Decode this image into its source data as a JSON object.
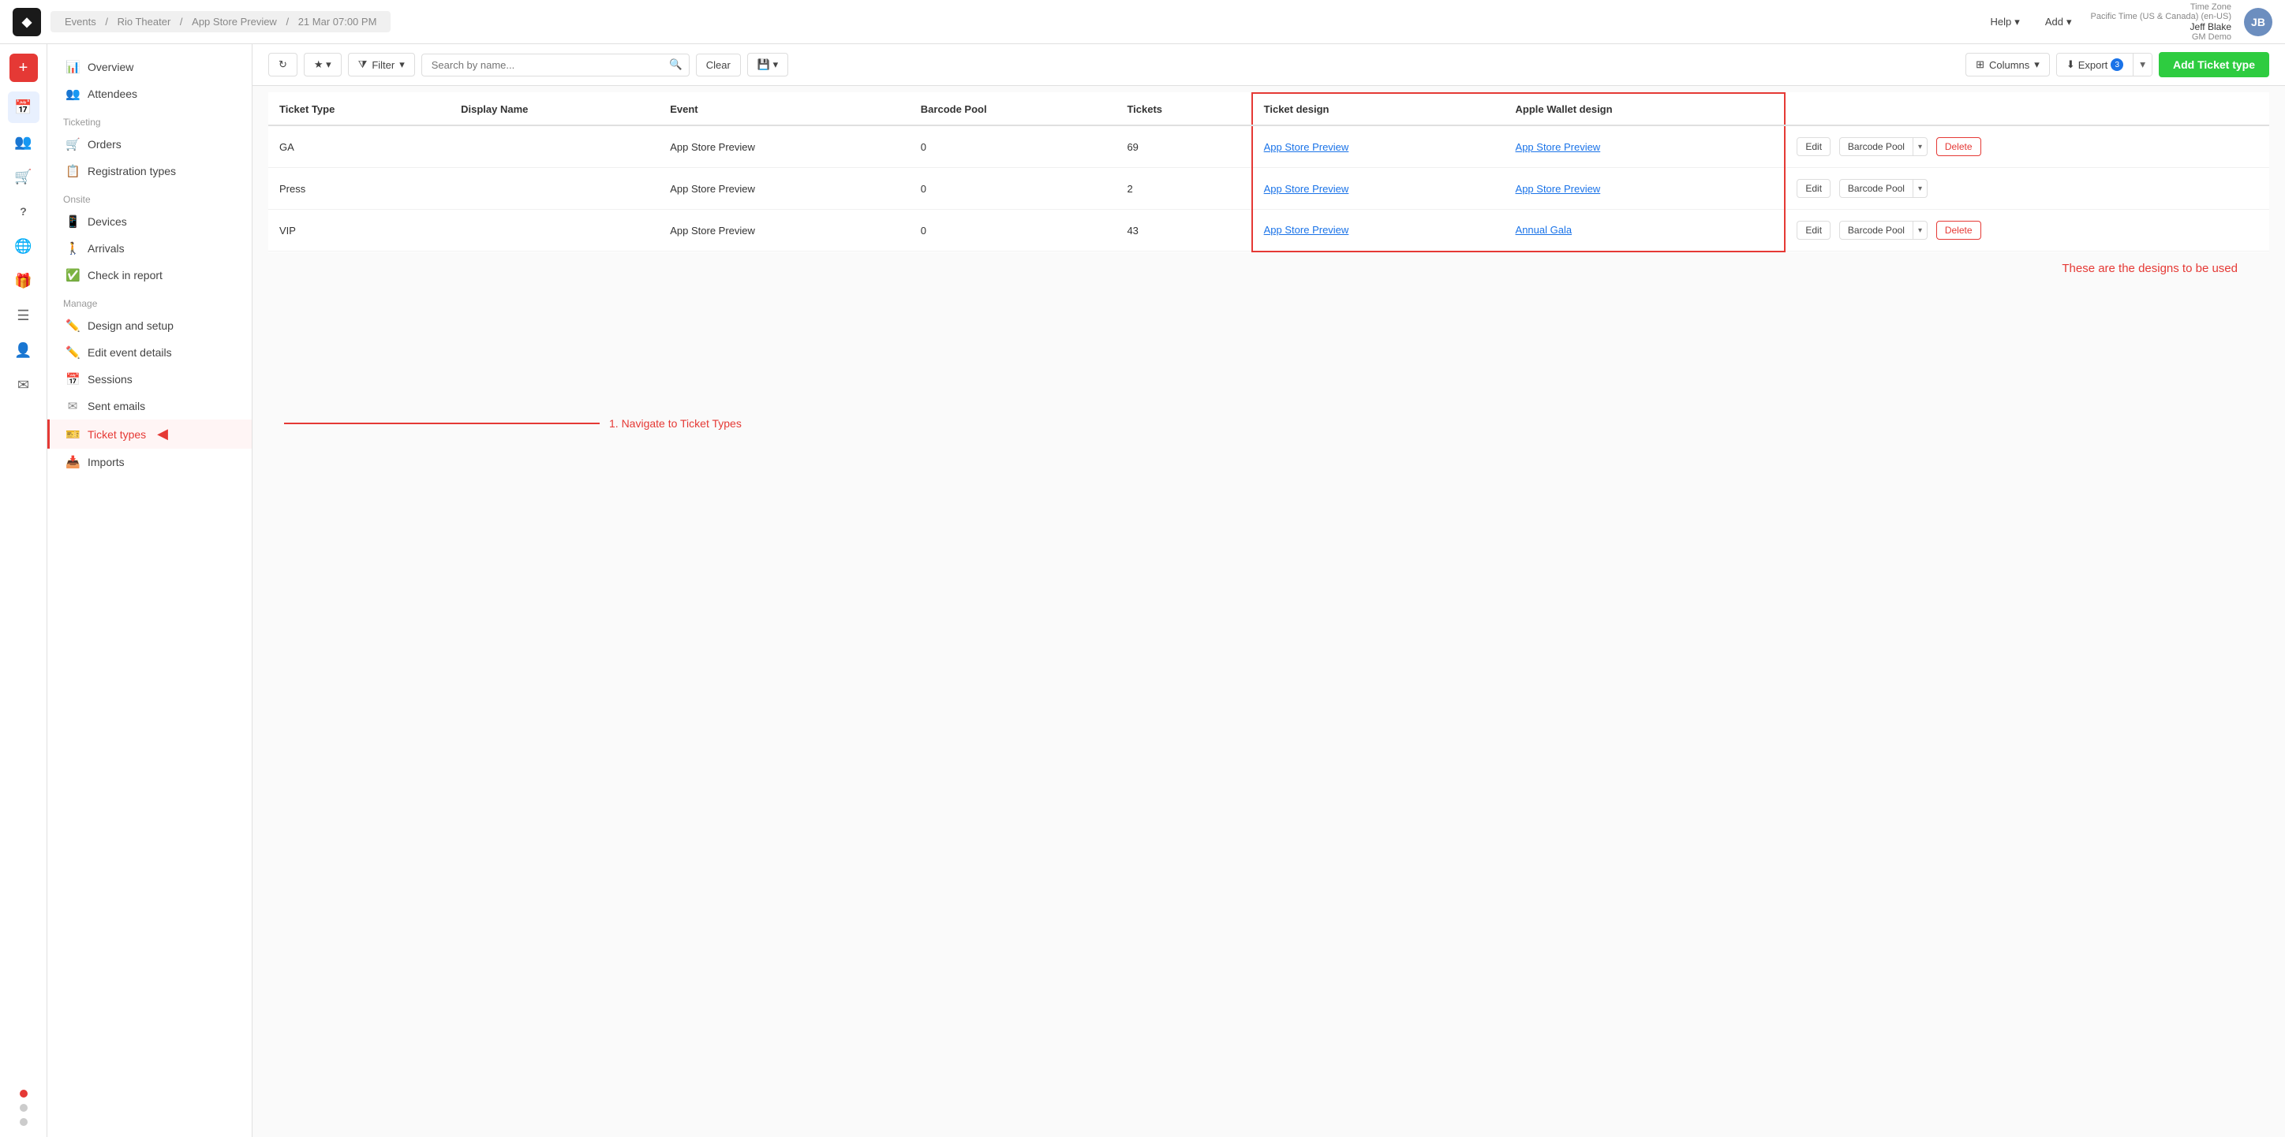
{
  "topbar": {
    "logo": "◆",
    "breadcrumb": {
      "events": "Events",
      "sep1": "/",
      "theater": "Rio Theater",
      "sep2": "/",
      "app_store": "App Store Preview",
      "sep3": "/",
      "date": "21 Mar 07:00 PM"
    },
    "help": "Help",
    "add": "Add",
    "timezone_label": "Time Zone",
    "timezone_value": "Pacific Time (US & Canada) (en-US)",
    "user_name": "Jeff Blake",
    "user_subtitle": "GM Demo",
    "avatar_initials": "JB"
  },
  "icon_sidebar": {
    "icons": [
      {
        "name": "home-icon",
        "glyph": "⊞",
        "active": false
      },
      {
        "name": "calendar-icon",
        "glyph": "📅",
        "active": true
      },
      {
        "name": "people-icon",
        "glyph": "👥",
        "active": false
      },
      {
        "name": "cart-icon",
        "glyph": "🛒",
        "active": false
      },
      {
        "name": "help-circle-icon",
        "glyph": "?",
        "active": false
      },
      {
        "name": "globe-icon",
        "glyph": "🌐",
        "active": false
      },
      {
        "name": "gift-icon",
        "glyph": "🎁",
        "active": false
      },
      {
        "name": "list-icon",
        "glyph": "☰",
        "active": false
      },
      {
        "name": "person-icon",
        "glyph": "👤",
        "active": false
      },
      {
        "name": "email-icon",
        "glyph": "✉",
        "active": false
      }
    ],
    "dots": [
      {
        "color": "#e53935"
      },
      {
        "color": "#f0f0f0"
      },
      {
        "color": "#f0f0f0"
      }
    ]
  },
  "left_nav": {
    "top_items": [
      {
        "label": "Overview",
        "icon": "📊"
      },
      {
        "label": "Attendees",
        "icon": "👥"
      }
    ],
    "ticketing_section": "Ticketing",
    "ticketing_items": [
      {
        "label": "Orders",
        "icon": "🛒"
      },
      {
        "label": "Registration types",
        "icon": "📋"
      }
    ],
    "onsite_section": "Onsite",
    "onsite_items": [
      {
        "label": "Devices",
        "icon": "📱"
      },
      {
        "label": "Arrivals",
        "icon": "🚶"
      },
      {
        "label": "Check in report",
        "icon": "✅"
      }
    ],
    "manage_section": "Manage",
    "manage_items": [
      {
        "label": "Design and setup",
        "icon": "✏️"
      },
      {
        "label": "Edit event details",
        "icon": "✏️"
      },
      {
        "label": "Sessions",
        "icon": "📅"
      },
      {
        "label": "Sent emails",
        "icon": "✉"
      },
      {
        "label": "Ticket types",
        "icon": "🎫",
        "active": true
      },
      {
        "label": "Imports",
        "icon": "📥"
      }
    ]
  },
  "toolbar": {
    "refresh_title": "Refresh",
    "star_title": "Favorite",
    "filter_label": "Filter",
    "search_placeholder": "Search by name...",
    "clear_label": "Clear",
    "save_icon_title": "Save view",
    "columns_label": "Columns",
    "export_label": "Export",
    "export_badge": "3",
    "add_ticket_label": "Add Ticket type"
  },
  "table": {
    "headers": [
      {
        "key": "ticket_type",
        "label": "Ticket Type"
      },
      {
        "key": "display_name",
        "label": "Display Name"
      },
      {
        "key": "event",
        "label": "Event"
      },
      {
        "key": "barcode_pool",
        "label": "Barcode Pool"
      },
      {
        "key": "tickets",
        "label": "Tickets"
      },
      {
        "key": "ticket_design",
        "label": "Ticket design"
      },
      {
        "key": "apple_wallet",
        "label": "Apple Wallet design"
      }
    ],
    "rows": [
      {
        "ticket_type": "GA",
        "display_name": "",
        "event": "App Store Preview",
        "barcode_pool": "0",
        "tickets": "69",
        "ticket_design": "App Store Preview",
        "apple_wallet_design": "App Store Preview",
        "has_delete": true
      },
      {
        "ticket_type": "Press",
        "display_name": "",
        "event": "App Store Preview",
        "barcode_pool": "0",
        "tickets": "2",
        "ticket_design": "App Store Preview",
        "apple_wallet_design": "App Store Preview",
        "has_delete": false
      },
      {
        "ticket_type": "VIP",
        "display_name": "",
        "event": "App Store Preview",
        "barcode_pool": "0",
        "tickets": "43",
        "ticket_design": "App Store Preview",
        "apple_wallet_design": "Annual Gala",
        "has_delete": true
      }
    ]
  },
  "annotations": {
    "design_box_label": "These are the designs to be used",
    "navigate_label": "1. Navigate to Ticket Types",
    "arrow": "←"
  }
}
